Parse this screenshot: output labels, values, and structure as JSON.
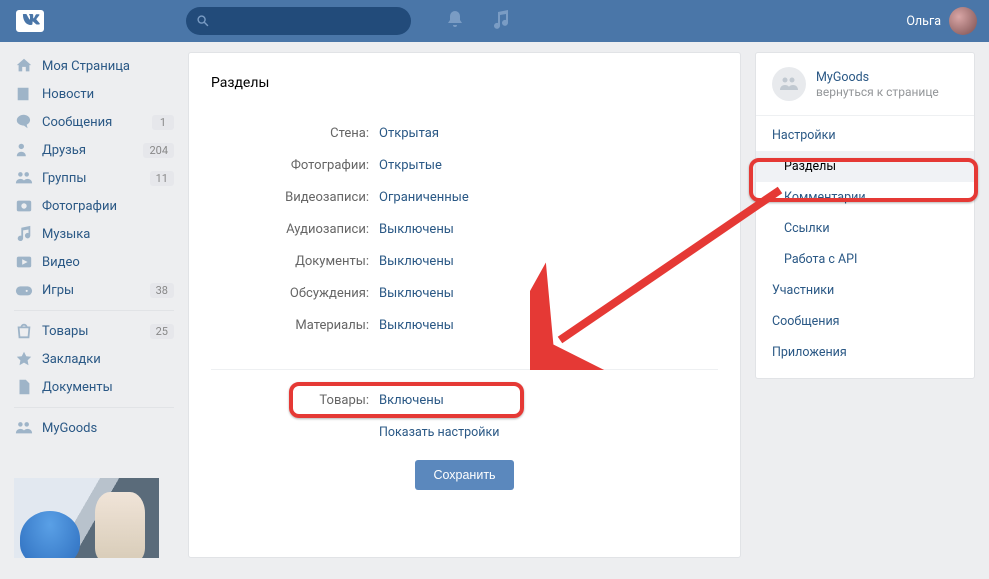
{
  "header": {
    "user_name": "Ольга"
  },
  "nav": {
    "items": [
      {
        "icon": "home",
        "label": "Моя Страница",
        "badge": ""
      },
      {
        "icon": "news",
        "label": "Новости",
        "badge": ""
      },
      {
        "icon": "msg",
        "label": "Сообщения",
        "badge": "1"
      },
      {
        "icon": "friends",
        "label": "Друзья",
        "badge": "204"
      },
      {
        "icon": "groups",
        "label": "Группы",
        "badge": "11"
      },
      {
        "icon": "photos",
        "label": "Фотографии",
        "badge": ""
      },
      {
        "icon": "music",
        "label": "Музыка",
        "badge": ""
      },
      {
        "icon": "video",
        "label": "Видео",
        "badge": ""
      },
      {
        "icon": "games",
        "label": "Игры",
        "badge": "38"
      }
    ],
    "items2": [
      {
        "icon": "market",
        "label": "Товары",
        "badge": "25"
      },
      {
        "icon": "bookmark",
        "label": "Закладки",
        "badge": ""
      },
      {
        "icon": "docs",
        "label": "Документы",
        "badge": ""
      }
    ],
    "items3": [
      {
        "icon": "group",
        "label": "MyGoods",
        "badge": ""
      }
    ]
  },
  "main": {
    "title": "Разделы",
    "rows": [
      {
        "label": "Стена:",
        "value": "Открытая"
      },
      {
        "label": "Фотографии:",
        "value": "Открытые"
      },
      {
        "label": "Видеозаписи:",
        "value": "Ограниченные"
      },
      {
        "label": "Аудиозаписи:",
        "value": "Выключены"
      },
      {
        "label": "Документы:",
        "value": "Выключены"
      },
      {
        "label": "Обсуждения:",
        "value": "Выключены"
      },
      {
        "label": "Материалы:",
        "value": "Выключены"
      }
    ],
    "goods_row": {
      "label": "Товары:",
      "value": "Включены"
    },
    "show_settings": "Показать настройки",
    "save": "Сохранить"
  },
  "group": {
    "name": "MyGoods",
    "back": "вернуться к странице",
    "links": [
      {
        "label": "Настройки",
        "sub": false,
        "active": false
      },
      {
        "label": "Разделы",
        "sub": true,
        "active": true
      },
      {
        "label": "Комментарии",
        "sub": true,
        "active": false
      },
      {
        "label": "Ссылки",
        "sub": true,
        "active": false
      },
      {
        "label": "Работа с API",
        "sub": true,
        "active": false
      },
      {
        "label": "Участники",
        "sub": false,
        "active": false
      },
      {
        "label": "Сообщения",
        "sub": false,
        "active": false
      },
      {
        "label": "Приложения",
        "sub": false,
        "active": false
      }
    ]
  }
}
